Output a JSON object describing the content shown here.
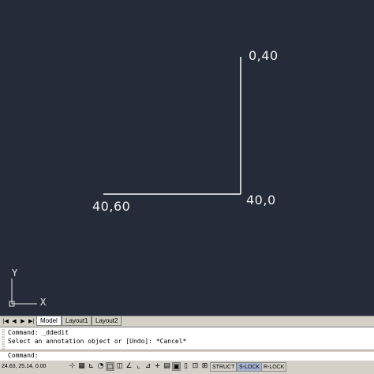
{
  "drawing": {
    "labels": {
      "top": "0,40",
      "corner": "40,0",
      "left": "40,60"
    },
    "ucs": {
      "y": "Y",
      "x": "X"
    },
    "colors": {
      "background": "#262b3a",
      "geometry": "#ffffff"
    }
  },
  "tabs": {
    "nav": [
      "first-icon",
      "prev-icon",
      "next-icon",
      "last-icon"
    ],
    "items": [
      "Model",
      "Layout1",
      "Layout2"
    ],
    "active": "Model"
  },
  "command": {
    "history": [
      "Command: _ddedit",
      "Select an annotation object or [Undo]: *Cancel*"
    ],
    "prompt": "Command:"
  },
  "status": {
    "coords": "24.63, 25.14, 0.00",
    "toggles": [
      "STRUCT",
      "S-LOCK",
      "R-LOCK"
    ]
  }
}
